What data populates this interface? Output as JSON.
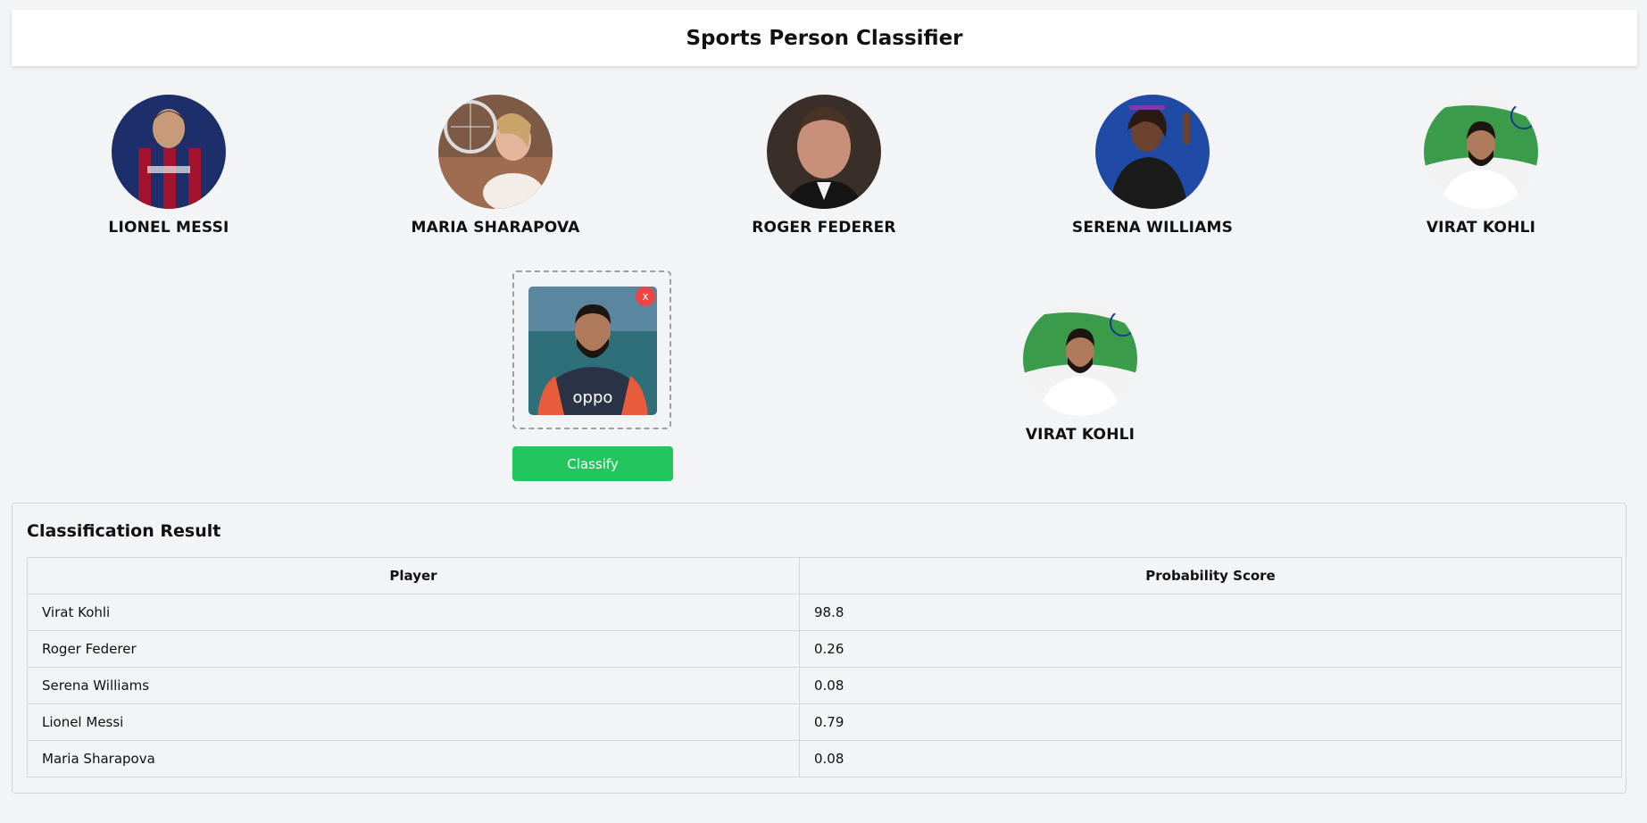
{
  "header": {
    "title": "Sports Person Classifier"
  },
  "players": [
    {
      "name": "LIONEL MESSI",
      "icon": "lionel-messi-photo"
    },
    {
      "name": "MARIA SHARAPOVA",
      "icon": "maria-sharapova-photo"
    },
    {
      "name": "ROGER FEDERER",
      "icon": "roger-federer-photo"
    },
    {
      "name": "SERENA WILLIAMS",
      "icon": "serena-williams-photo"
    },
    {
      "name": "VIRAT KOHLI",
      "icon": "virat-kohli-photo"
    }
  ],
  "upload": {
    "remove_label": "x",
    "classify_label": "Classify"
  },
  "prediction": {
    "name": "VIRAT KOHLI"
  },
  "result": {
    "title": "Classification Result",
    "columns": [
      "Player",
      "Probability Score"
    ],
    "rows": [
      [
        "Virat Kohli",
        "98.8"
      ],
      [
        "Roger Federer",
        "0.26"
      ],
      [
        "Serena Williams",
        "0.08"
      ],
      [
        "Lionel Messi",
        "0.79"
      ],
      [
        "Maria Sharapova",
        "0.08"
      ]
    ]
  },
  "colors": {
    "background": "#f3f4f6",
    "classify_button": "#22c55e",
    "remove_button": "#ef4444"
  }
}
